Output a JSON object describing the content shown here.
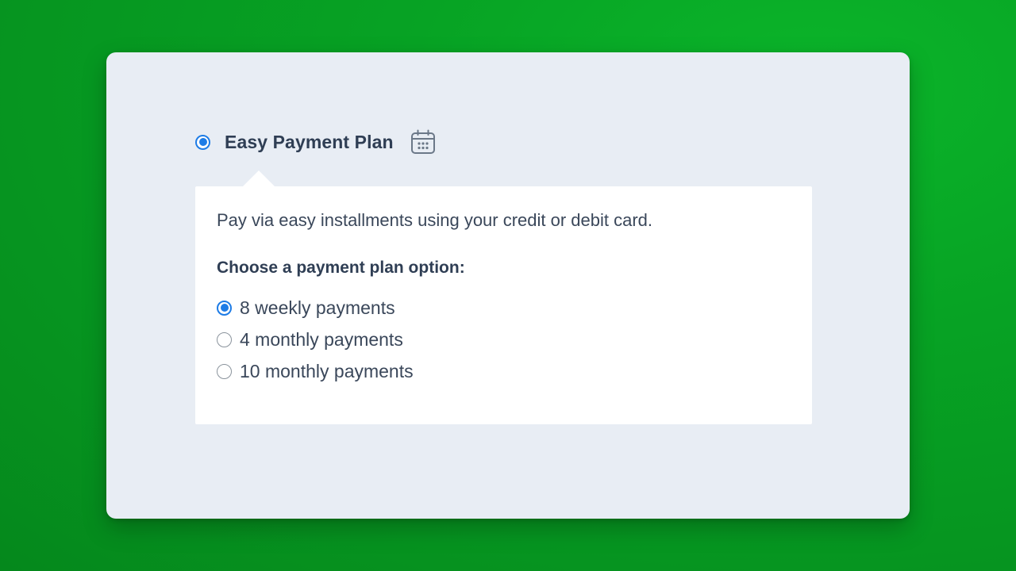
{
  "plan": {
    "title": "Easy Payment Plan",
    "selected": true,
    "icon": "calendar-icon"
  },
  "details": {
    "description": "Pay via easy installments using your credit or debit card.",
    "options_heading": "Choose a payment plan option:",
    "options": [
      {
        "label": "8 weekly payments",
        "selected": true
      },
      {
        "label": "4 monthly payments",
        "selected": false
      },
      {
        "label": "10 monthly payments",
        "selected": false
      }
    ]
  },
  "colors": {
    "background": "#07a324",
    "panel": "#e8edf4",
    "accent": "#1e7ce6",
    "text": "#2f3e54"
  }
}
